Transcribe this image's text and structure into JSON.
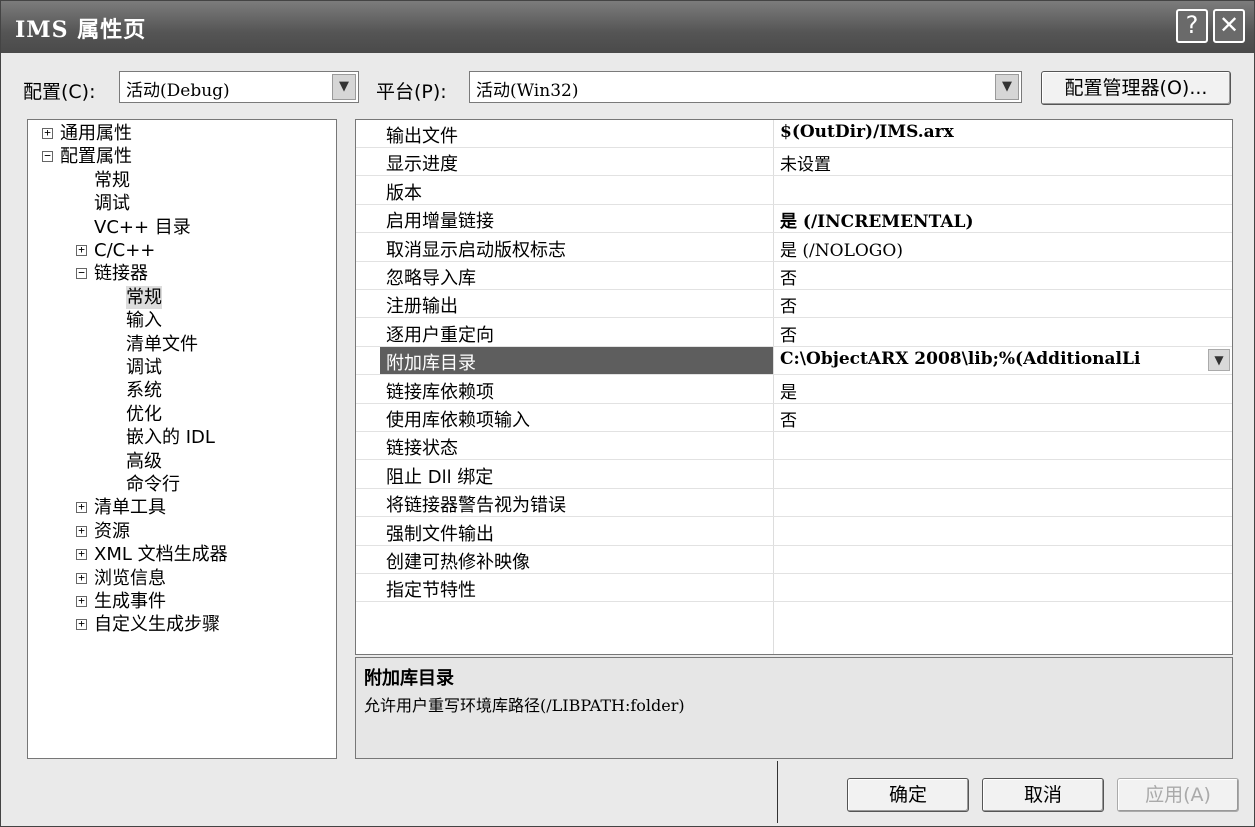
{
  "window": {
    "title": "IMS 属性页",
    "help_glyph": "?",
    "close_glyph": "✕"
  },
  "config": {
    "label": "配置(C):",
    "value": "活动(Debug)"
  },
  "platform": {
    "label": "平台(P):",
    "value": "活动(Win32)"
  },
  "config_manager_label": "配置管理器(O)...",
  "tree": [
    {
      "label": "通用属性",
      "level": 0,
      "toggle": "+"
    },
    {
      "label": "配置属性",
      "level": 0,
      "toggle": "−"
    },
    {
      "label": "常规",
      "level": 1,
      "toggle": ""
    },
    {
      "label": "调试",
      "level": 1,
      "toggle": ""
    },
    {
      "label": "VC++ 目录",
      "level": 1,
      "toggle": ""
    },
    {
      "label": "C/C++",
      "level": 1,
      "toggle": "+"
    },
    {
      "label": "链接器",
      "level": 1,
      "toggle": "−"
    },
    {
      "label": "常规",
      "level": 2,
      "toggle": "",
      "selected": true
    },
    {
      "label": "输入",
      "level": 2,
      "toggle": ""
    },
    {
      "label": "清单文件",
      "level": 2,
      "toggle": ""
    },
    {
      "label": "调试",
      "level": 2,
      "toggle": ""
    },
    {
      "label": "系统",
      "level": 2,
      "toggle": ""
    },
    {
      "label": "优化",
      "level": 2,
      "toggle": ""
    },
    {
      "label": "嵌入的 IDL",
      "level": 2,
      "toggle": ""
    },
    {
      "label": "高级",
      "level": 2,
      "toggle": ""
    },
    {
      "label": "命令行",
      "level": 2,
      "toggle": ""
    },
    {
      "label": "清单工具",
      "level": 1,
      "toggle": "+"
    },
    {
      "label": "资源",
      "level": 1,
      "toggle": "+"
    },
    {
      "label": "XML 文档生成器",
      "level": 1,
      "toggle": "+"
    },
    {
      "label": "浏览信息",
      "level": 1,
      "toggle": "+"
    },
    {
      "label": "生成事件",
      "level": 1,
      "toggle": "+"
    },
    {
      "label": "自定义生成步骤",
      "level": 1,
      "toggle": "+"
    }
  ],
  "properties": [
    {
      "name": "输出文件",
      "value": "$(OutDir)/IMS.arx",
      "bold": true
    },
    {
      "name": "显示进度",
      "value": "未设置",
      "bold": false
    },
    {
      "name": "版本",
      "value": "",
      "bold": false
    },
    {
      "name": "启用增量链接",
      "value": "是 (/INCREMENTAL)",
      "bold": true
    },
    {
      "name": "取消显示启动版权标志",
      "value": "是 (/NOLOGO)",
      "bold": false
    },
    {
      "name": "忽略导入库",
      "value": "否",
      "bold": false
    },
    {
      "name": "注册输出",
      "value": "否",
      "bold": false
    },
    {
      "name": "逐用户重定向",
      "value": "否",
      "bold": false
    },
    {
      "name": "附加库目录",
      "value": "C:\\ObjectARX 2008\\lib;%(AdditionalLi",
      "bold": true,
      "selected": true
    },
    {
      "name": "链接库依赖项",
      "value": "是",
      "bold": false
    },
    {
      "name": "使用库依赖项输入",
      "value": "否",
      "bold": false
    },
    {
      "name": "链接状态",
      "value": "",
      "bold": false
    },
    {
      "name": "阻止 Dll 绑定",
      "value": "",
      "bold": false
    },
    {
      "name": "将链接器警告视为错误",
      "value": "",
      "bold": false
    },
    {
      "name": "强制文件输出",
      "value": "",
      "bold": false
    },
    {
      "name": "创建可热修补映像",
      "value": "",
      "bold": false
    },
    {
      "name": "指定节特性",
      "value": "",
      "bold": false
    }
  ],
  "description": {
    "title": "附加库目录",
    "text": "允许用户重写环境库路径(/LIBPATH:folder)"
  },
  "buttons": {
    "ok": "确定",
    "cancel": "取消",
    "apply": "应用(A)"
  },
  "icons": {
    "dropdown": "chevron-down-icon",
    "help": "help-icon",
    "close": "close-icon"
  }
}
